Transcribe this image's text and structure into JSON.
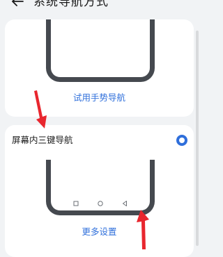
{
  "header": {
    "back_icon": "arrow-left-icon",
    "title": "系统导航方式"
  },
  "gesture_option": {
    "link_label": "试用手势导航"
  },
  "three_key_option": {
    "label": "屏幕内三键导航",
    "selected": true,
    "nav_keys": [
      "square-icon",
      "circle-icon",
      "triangle-left-icon"
    ],
    "link_label": "更多设置"
  },
  "colors": {
    "background": "#f1f3f5",
    "card": "#ffffff",
    "accent": "#2f6fdb",
    "phone_outline": "#45494f",
    "annotation_arrow": "#e8262e"
  }
}
